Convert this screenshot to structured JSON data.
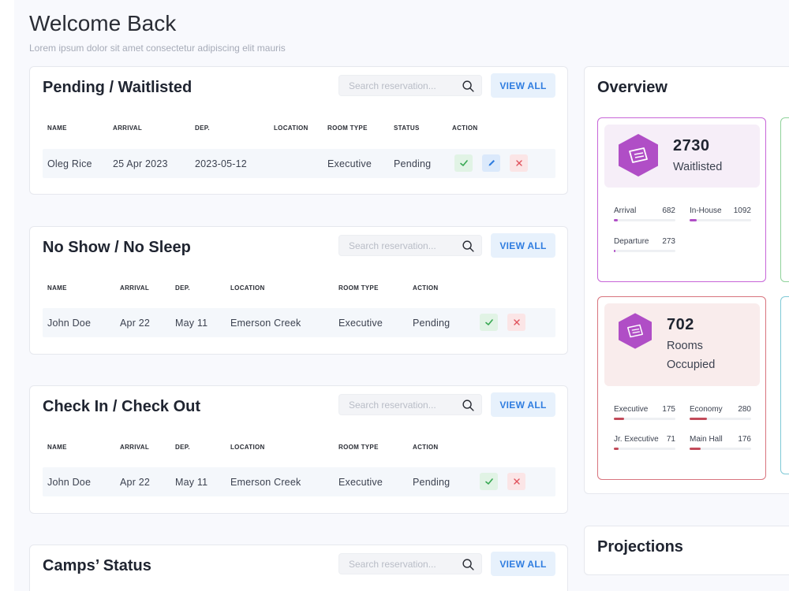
{
  "header": {
    "title": "Welcome Back",
    "subtitle": "Lorem ipsum dolor sit amet consectetur adipiscing elit mauris"
  },
  "common": {
    "search_placeholder": "Search reservation...",
    "view_all": "VIEW ALL"
  },
  "pending": {
    "title": "Pending / Waitlisted",
    "columns": [
      "NAME",
      "ARRIVAL",
      "DEP.",
      "LOCATION",
      "ROOM TYPE",
      "STATUS",
      "ACTION"
    ],
    "rows": [
      {
        "name": "Oleg Rice",
        "arrival": "25 Apr 2023",
        "dep": "2023-05-12",
        "location": "",
        "room_type": "Executive",
        "status": "Pending"
      }
    ]
  },
  "noshow": {
    "title": "No Show / No Sleep",
    "columns": [
      "NAME",
      "ARRIVAL",
      "DEP.",
      "LOCATION",
      "ROOM TYPE",
      "ACTION"
    ],
    "rows": [
      {
        "name": "John Doe",
        "arrival": "Apr 22",
        "dep": "May 11",
        "location": "Emerson Creek",
        "room_type": "Executive",
        "status": "Pending"
      }
    ]
  },
  "checkin": {
    "title": "Check In / Check Out",
    "columns": [
      "NAME",
      "ARRIVAL",
      "DEP.",
      "LOCATION",
      "ROOM TYPE",
      "ACTION"
    ],
    "rows": [
      {
        "name": "John Doe",
        "arrival": "Apr 22",
        "dep": "May 11",
        "location": "Emerson Creek",
        "room_type": "Executive",
        "status": "Pending"
      }
    ]
  },
  "camps": {
    "title": "Camps’ Status"
  },
  "overview": {
    "title": "Overview",
    "waitlisted": {
      "value": "2730",
      "label": "Waitlisted",
      "accent": "#b04ec6",
      "stats": [
        {
          "label": "Arrival",
          "value": "682"
        },
        {
          "label": "In-House",
          "value": "1092"
        },
        {
          "label": "Departure",
          "value": "273"
        }
      ]
    },
    "occupied": {
      "value": "702",
      "label_line1": "Rooms",
      "label_line2": "Occupied",
      "accent": "#c24b5a",
      "stats": [
        {
          "label": "Executive",
          "value": "175"
        },
        {
          "label": "Economy",
          "value": "280"
        },
        {
          "label": "Jr. Executive",
          "value": "71"
        },
        {
          "label": "Main Hall",
          "value": "176"
        }
      ]
    }
  },
  "projections": {
    "title": "Projections"
  }
}
